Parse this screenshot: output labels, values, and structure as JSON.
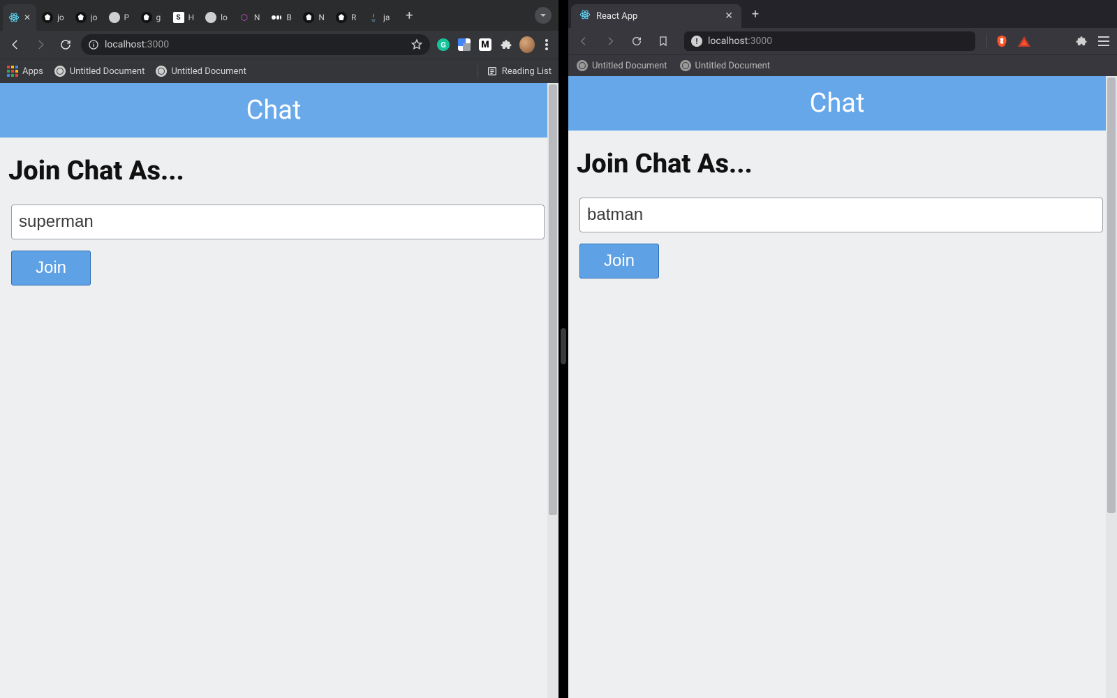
{
  "left": {
    "browser": "chrome",
    "tabs": [
      {
        "fav": "react",
        "label": "",
        "active": true,
        "close": true
      },
      {
        "fav": "github",
        "label": "jo"
      },
      {
        "fav": "github",
        "label": "jo"
      },
      {
        "fav": "globe",
        "label": "P"
      },
      {
        "fav": "github",
        "label": "g"
      },
      {
        "fav": "square-s",
        "label": "H"
      },
      {
        "fav": "globe",
        "label": "lo"
      },
      {
        "fav": "hex",
        "label": "N"
      },
      {
        "fav": "medium-dots",
        "label": "B"
      },
      {
        "fav": "github",
        "label": "N"
      },
      {
        "fav": "github",
        "label": "R"
      },
      {
        "fav": "java",
        "label": "ja"
      }
    ],
    "addressbar": {
      "scheme_icon": "info",
      "host": "localhost",
      "port": ":3000"
    },
    "toolbar_icons": [
      "grammarly",
      "gtranslate",
      "medium",
      "puzzle",
      "avatar",
      "menu"
    ],
    "bookmarks": {
      "apps_label": "Apps",
      "items": [
        "Untitled Document",
        "Untitled Document"
      ],
      "reading_list": "Reading List"
    },
    "page": {
      "banner": "Chat",
      "heading": "Join Chat As...",
      "input_value": "superman",
      "button": "Join"
    }
  },
  "right": {
    "browser": "brave",
    "tab": {
      "fav": "react",
      "label": "React App",
      "close": true
    },
    "addressbar": {
      "alert": "!",
      "host": "localhost",
      "port": ":3000"
    },
    "bookmarks": {
      "items": [
        "Untitled Document",
        "Untitled Document"
      ]
    },
    "page": {
      "banner": "Chat",
      "heading": "Join Chat As...",
      "input_value": "batman",
      "button": "Join"
    }
  }
}
